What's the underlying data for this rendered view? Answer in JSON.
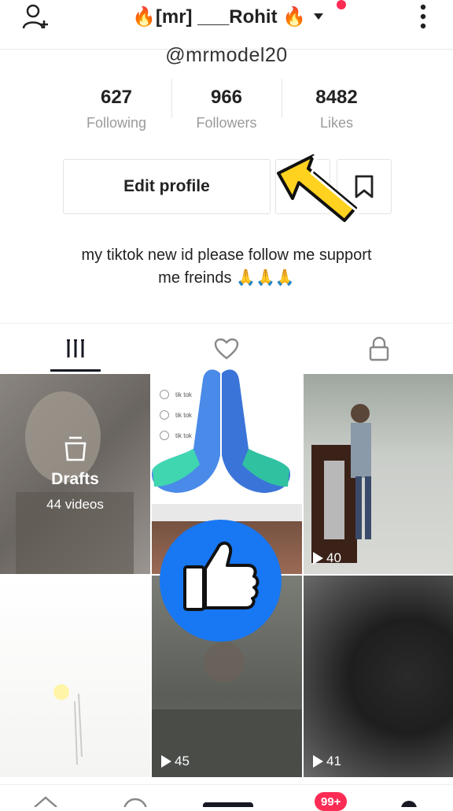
{
  "header": {
    "title": "🔥[mr] ___Rohit 🔥",
    "username": "@mrmodel20"
  },
  "stats": [
    {
      "value": "627",
      "label": "Following"
    },
    {
      "value": "966",
      "label": "Followers"
    },
    {
      "value": "8482",
      "label": "Likes"
    }
  ],
  "actions": {
    "edit_profile_label": "Edit profile"
  },
  "bio": {
    "line1": "my tiktok new  id please follow me support",
    "line2": "me freinds 🙏🙏🙏"
  },
  "grid": {
    "drafts_title": "Drafts",
    "drafts_count": "44 videos",
    "views": [
      "40",
      "45",
      "41"
    ],
    "screenshot_rows": [
      "tik tok",
      "tik tok",
      "tik tok"
    ]
  },
  "bottom_nav": {
    "inbox_badge": "99+"
  },
  "colors": {
    "accent": "#fe2c55",
    "like_blue": "#1877f2",
    "arrow_yellow": "#ffd21f"
  }
}
